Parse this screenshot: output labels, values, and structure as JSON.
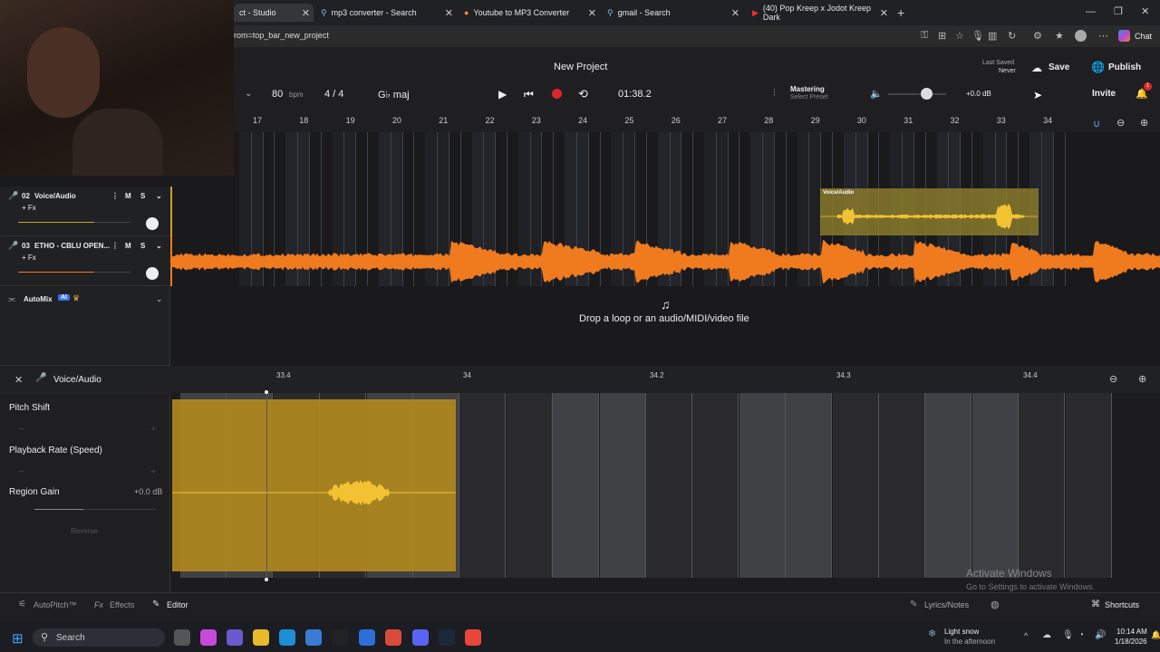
{
  "browser": {
    "tabs": [
      {
        "title": "ct - Studio",
        "active": true
      },
      {
        "title": "mp3 converter - Search"
      },
      {
        "title": "Youtube to MP3 Converter"
      },
      {
        "title": "gmail - Search"
      },
      {
        "title": "(40) Pop Kreep x Jodot Kreep Dark"
      }
    ],
    "url": "rom=top_bar_new_project",
    "chat_label": "Chat"
  },
  "header": {
    "project_title": "New Project",
    "last_saved_label": "Last Saved",
    "last_saved_value": "Never",
    "save_label": "Save",
    "publish_label": "Publish",
    "invite_label": "Invite",
    "notification_count": "1"
  },
  "transport": {
    "bpm_value": "80",
    "bpm_unit": "bpm",
    "time_signature": "4 / 4",
    "key": "G♭ maj",
    "time_display": "01:38.2",
    "mastering_label": "Mastering",
    "mastering_preset": "Select Preset",
    "master_gain": "+0.0 dB"
  },
  "ruler": {
    "bars": [
      "17",
      "18",
      "19",
      "20",
      "21",
      "22",
      "23",
      "24",
      "25",
      "26",
      "27",
      "28",
      "29",
      "30",
      "31",
      "32",
      "33",
      "34"
    ]
  },
  "tracks": [
    {
      "number": "02",
      "name": "Voice/Audio",
      "fx": "+ Fx",
      "clip_label": "Voice/Audio"
    },
    {
      "number": "03",
      "name": "ETHO - CBLU OPEN...",
      "fx": "+ Fx"
    }
  ],
  "automix": {
    "label": "AutoMix",
    "badge": "AI"
  },
  "drop_zone": {
    "text": "Drop a loop or an audio/MIDI/video file"
  },
  "editor": {
    "title": "Voice/Audio",
    "ruler": [
      "33.4",
      "34",
      "34.2",
      "34.3",
      "34.4"
    ],
    "pitch_shift_label": "Pitch Shift",
    "playback_rate_label": "Playback Rate (Speed)",
    "region_gain_label": "Region Gain",
    "region_gain_value": "+0.0 dB",
    "reverse_label": "Reverse"
  },
  "bottom_bar": {
    "autopitch": "AutoPitch™",
    "effects": "Effects",
    "editor": "Editor",
    "lyrics": "Lyrics/Notes",
    "shortcuts": "Shortcuts"
  },
  "watermark": {
    "line1": "Activate Windows",
    "line2": "Go to Settings to activate Windows."
  },
  "taskbar": {
    "search": "Search",
    "weather_title": "Light snow",
    "weather_sub": "In the afternoon",
    "time": "10:14 AM",
    "date": "1/18/2026"
  },
  "colors": {
    "accent_orange": "#f07a1e",
    "accent_gold": "#c9a227",
    "record_red": "#e0262d"
  }
}
